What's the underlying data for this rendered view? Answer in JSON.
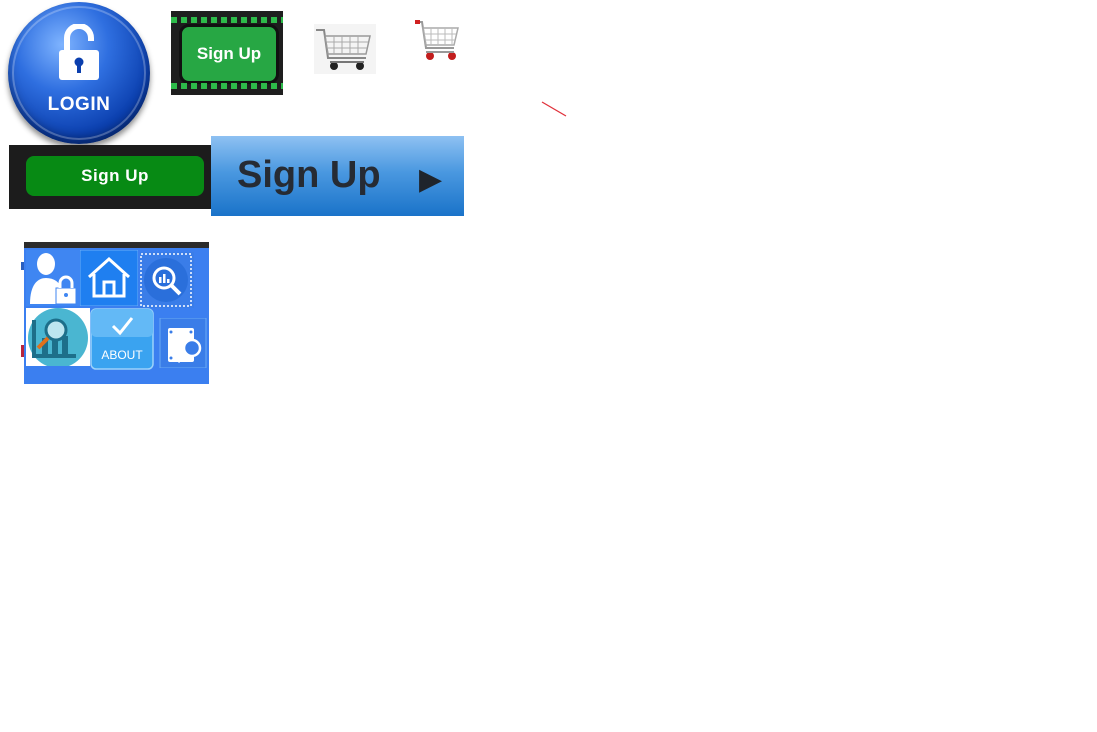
{
  "login": {
    "label": "LOGIN"
  },
  "signup_small": {
    "label": "Sign Up"
  },
  "signup_dark": {
    "label": "Sign Up"
  },
  "signup_blue": {
    "label": "Sign Up",
    "arrow": "▶"
  },
  "icon_grid": {
    "about_label": "ABOUT",
    "check_mark": "✓"
  },
  "colors": {
    "login_blue": "#0b3fae",
    "green": "#27a744",
    "dark_green": "#078a14",
    "blue_button": "#4a98e0",
    "grid_blue": "#3b7ff0"
  },
  "icons": [
    "lock-icon",
    "shopping-cart-icon",
    "user-lock-icon",
    "home-icon",
    "search-chart-icon",
    "analytics-search-icon",
    "about-check-icon",
    "document-search-icon"
  ]
}
